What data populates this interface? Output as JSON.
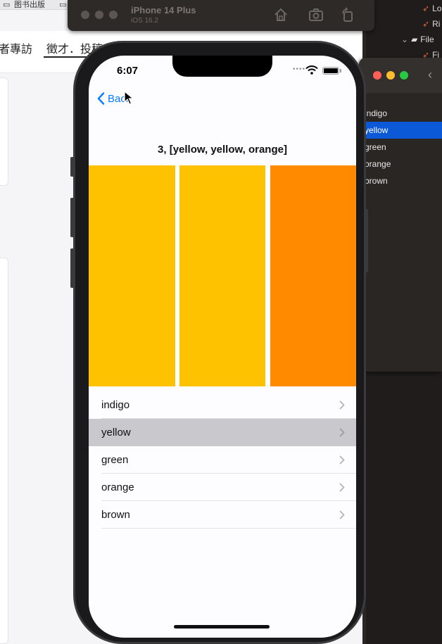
{
  "background": {
    "web_topbar": {
      "bookmark_label": "图书出版"
    },
    "web_nav": {
      "item_left": "者專訪",
      "item_active": "徵才．投稿"
    },
    "simulator": {
      "device_name": "iPhone 14 Plus",
      "os_version": "iOS 16.2"
    },
    "xcode": {
      "top_items": [
        "Lo",
        "Ri",
        "File",
        "Fi"
      ],
      "preview_list": [
        "indigo",
        "yellow",
        "green",
        "orange",
        "brown"
      ],
      "preview_selected_index": 1
    }
  },
  "phone": {
    "status_bar": {
      "time": "6:07"
    },
    "nav": {
      "back_label": "Back"
    },
    "title": "3, [yellow, yellow, orange]",
    "swatches": [
      {
        "name": "yellow",
        "color": "#ffc200"
      },
      {
        "name": "yellow",
        "color": "#ffc200"
      },
      {
        "name": "orange",
        "color": "#ff8a00"
      }
    ],
    "list": {
      "items": [
        "indigo",
        "yellow",
        "green",
        "orange",
        "brown"
      ],
      "selected_index": 1
    }
  },
  "colors": {
    "accent_blue": "#0a7aff",
    "selection_gray": "#c8c8cd",
    "xcode_selection": "#0b59d6"
  }
}
